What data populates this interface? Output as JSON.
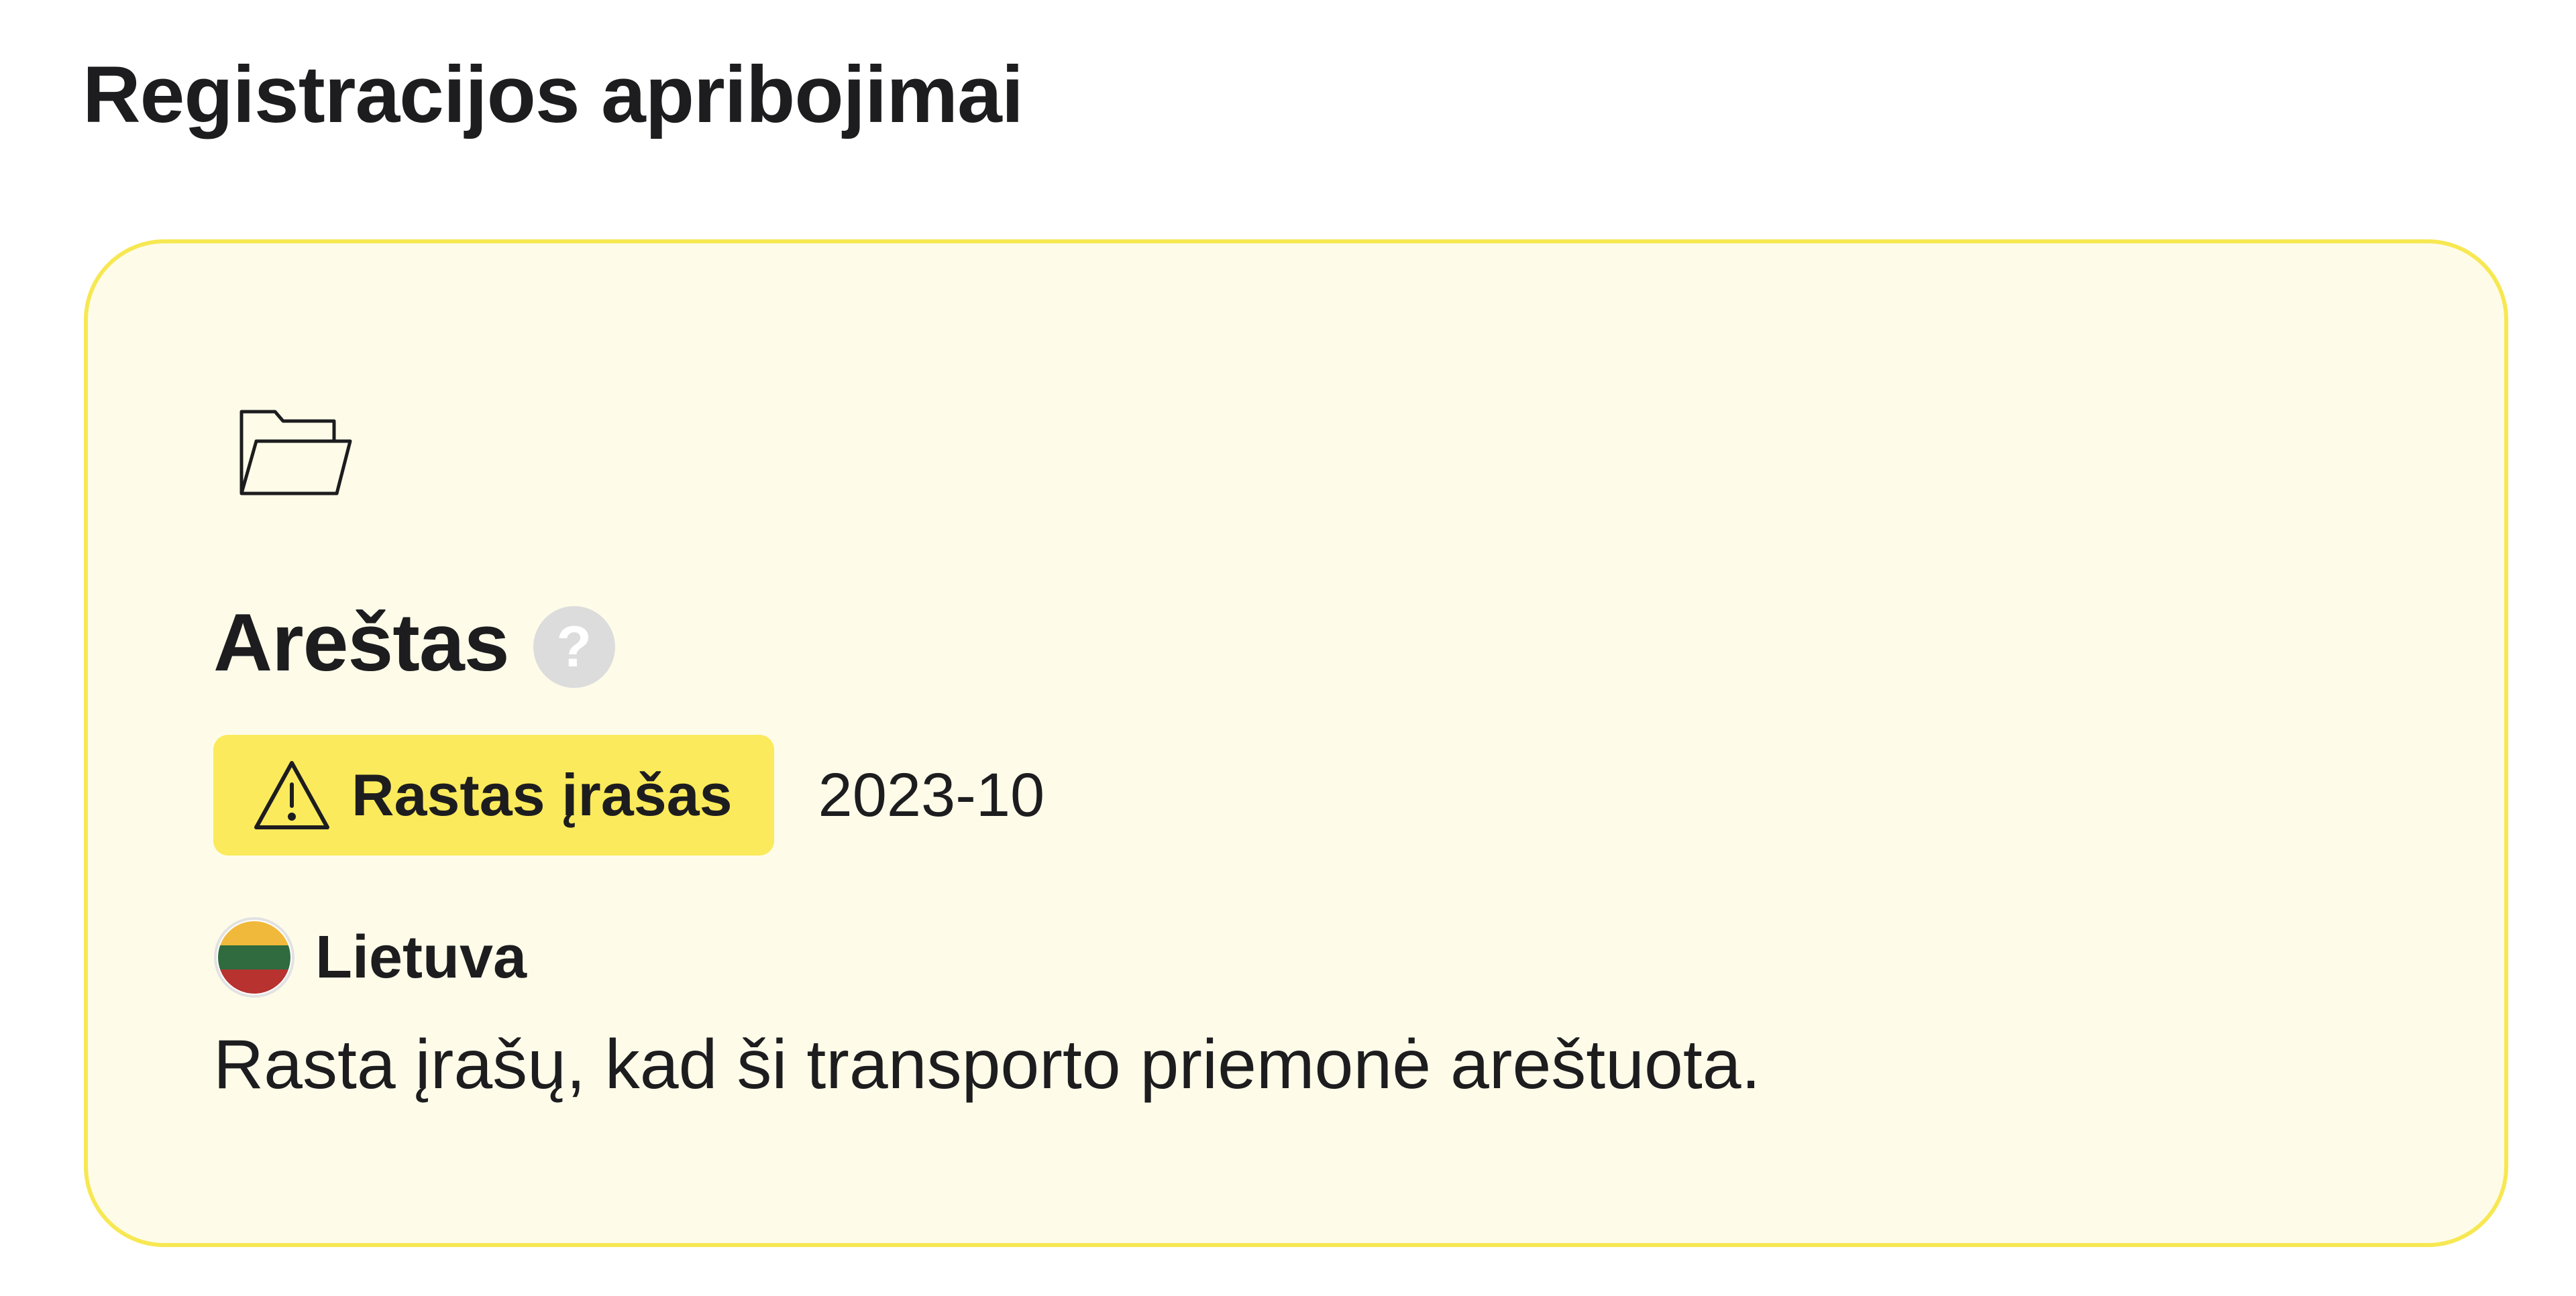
{
  "section": {
    "title": "Registracijos apribojimai"
  },
  "restriction": {
    "icon": "folder-icon",
    "title": "Areštas",
    "help_icon": "question-mark-icon",
    "help_symbol": "?",
    "status": {
      "icon": "warning-triangle-icon",
      "label": "Rastas įrašas",
      "color": "#fbea5b"
    },
    "date": "2023-10",
    "country": {
      "flag_icon": "lithuania-flag-icon",
      "name": "Lietuva"
    },
    "description": "Rasta įrašų, kad ši transporto priemonė areštuota."
  },
  "colors": {
    "card_background": "#fefce9",
    "card_border": "#f7e853",
    "badge_background": "#fbea5b",
    "help_icon_background": "#dcdcdc",
    "text": "#1d1d1f"
  }
}
